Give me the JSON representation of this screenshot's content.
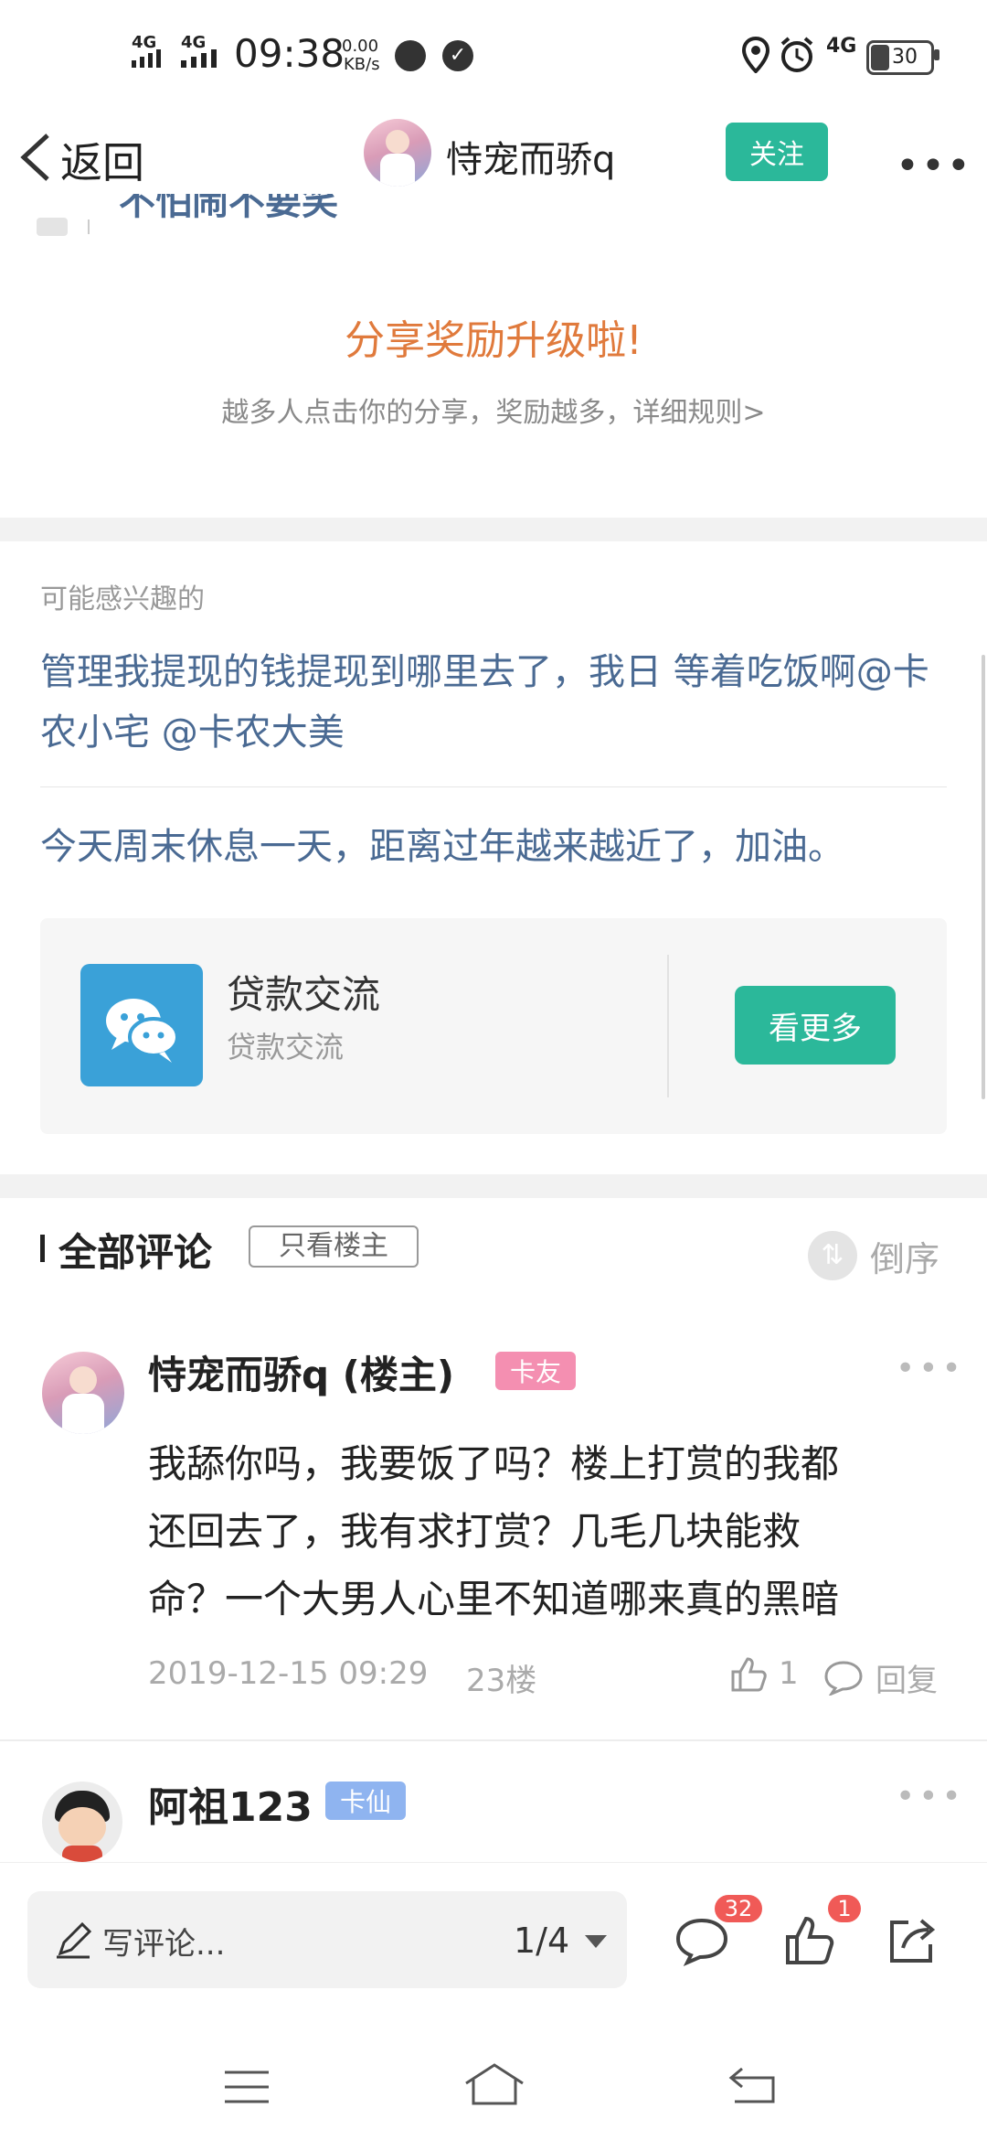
{
  "status_bar": {
    "signal1": "4G",
    "signal2": "4G",
    "time": "09:38",
    "speed_value": "0.00",
    "speed_unit": "KB/s",
    "network": "4G",
    "battery": "30"
  },
  "nav": {
    "back_label": "返回",
    "title": "恃宠而骄q",
    "follow_label": "关注"
  },
  "partial_text": "不怕闹不要笑",
  "share": {
    "title": "分享奖励升级啦!",
    "subtitle": "越多人点击你的分享，奖励越多，详细规则>"
  },
  "interest": {
    "label": "可能感兴趣的",
    "items": [
      {
        "text": "管理我提现的钱提现到哪里去了，我日 等着吃饭啊@卡农小宅 @卡农大美"
      },
      {
        "text": "今天周末休息一天，距离过年越来越近了，加油。"
      }
    ],
    "card": {
      "title": "贷款交流",
      "subtitle": "贷款交流",
      "button": "看更多"
    }
  },
  "comments_header": {
    "title": "全部评论",
    "only_op": "只看楼主",
    "sort": "倒序"
  },
  "comments": [
    {
      "author": "恃宠而骄q (楼主)",
      "tag": "卡友",
      "body_lines": [
        "我舔你吗，我要饭了吗？楼上打赏的我都",
        "还回去了，我有求打赏？几毛几块能救",
        "命？一个大男人心里不知道哪来真的黑暗"
      ],
      "time": "2019-12-15 09:29",
      "floor": "23楼",
      "likes": "1",
      "reply_label": "回复"
    },
    {
      "author": "阿祖123",
      "tag": "卡仙"
    }
  ],
  "bottom_bar": {
    "placeholder": "写评论...",
    "page": "1/4",
    "comment_count": "32",
    "like_count": "1"
  },
  "colors": {
    "accent": "#2bb89a",
    "share_title": "#e07a3c",
    "link": "#4a6a93",
    "tag_pink": "#f48fb1",
    "tag_blue": "#8fb4f0",
    "badge": "#f05a57"
  }
}
